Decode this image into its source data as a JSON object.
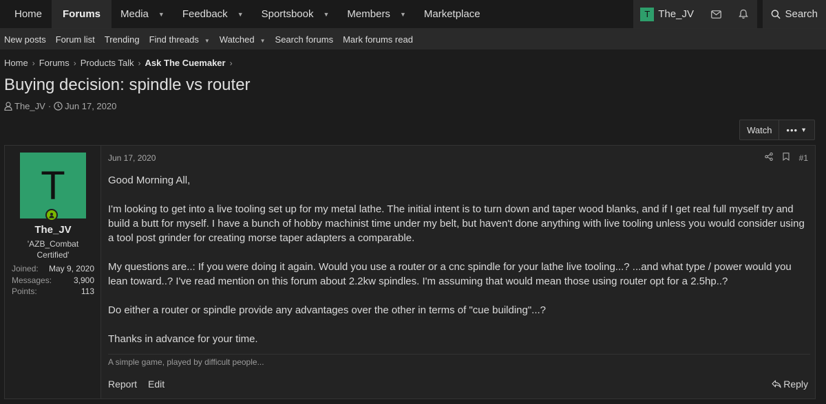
{
  "topnav": {
    "items": [
      {
        "label": "Home",
        "active": false,
        "dropdown": false
      },
      {
        "label": "Forums",
        "active": true,
        "dropdown": false
      },
      {
        "label": "Media",
        "active": false,
        "dropdown": true
      },
      {
        "label": "Feedback",
        "active": false,
        "dropdown": true
      },
      {
        "label": "Sportsbook",
        "active": false,
        "dropdown": true
      },
      {
        "label": "Members",
        "active": false,
        "dropdown": true
      },
      {
        "label": "Marketplace",
        "active": false,
        "dropdown": false
      }
    ],
    "user_initial": "T",
    "username": "The_JV",
    "search_label": "Search"
  },
  "subnav": {
    "items": [
      {
        "label": "New posts",
        "dropdown": false
      },
      {
        "label": "Forum list",
        "dropdown": false
      },
      {
        "label": "Trending",
        "dropdown": false
      },
      {
        "label": "Find threads",
        "dropdown": true
      },
      {
        "label": "Watched",
        "dropdown": true
      },
      {
        "label": "Search forums",
        "dropdown": false
      },
      {
        "label": "Mark forums read",
        "dropdown": false
      }
    ]
  },
  "breadcrumb": [
    "Home",
    "Forums",
    "Products Talk",
    "Ask The Cuemaker"
  ],
  "thread": {
    "title": "Buying decision: spindle vs router",
    "author": "The_JV",
    "date": "Jun 17, 2020",
    "watch_label": "Watch",
    "more_label": "•••"
  },
  "post": {
    "user": {
      "initial": "T",
      "name": "The_JV",
      "title": "'AZB_Combat Certified'",
      "joined_label": "Joined:",
      "joined": "May 9, 2020",
      "messages_label": "Messages:",
      "messages": "3,900",
      "points_label": "Points:",
      "points": "113"
    },
    "date": "Jun 17, 2020",
    "number": "#1",
    "paragraphs": [
      "Good Morning All,",
      "I'm looking to get into a live tooling set up for my metal lathe. The initial intent is to turn down and taper wood blanks, and if I get real full myself try and build a butt for myself. I have a bunch of hobby machinist time under my belt, but haven't done anything with live tooling unless you would consider using a tool post grinder for creating morse taper adapters a comparable.",
      "My questions are..: If you were doing it again. Would you use a router or a cnc spindle for your lathe live tooling...? ...and what type / power would you lean toward..? I've read mention on this forum about 2.2kw spindles. I'm assuming that would mean those using router opt for a 2.5hp..?",
      "Do either a router or spindle provide any advantages over the other in terms of \"cue building\"...?",
      "Thanks in advance for your time."
    ],
    "signature": "A simple game, played by difficult people...",
    "report_label": "Report",
    "edit_label": "Edit",
    "reply_label": "Reply"
  }
}
